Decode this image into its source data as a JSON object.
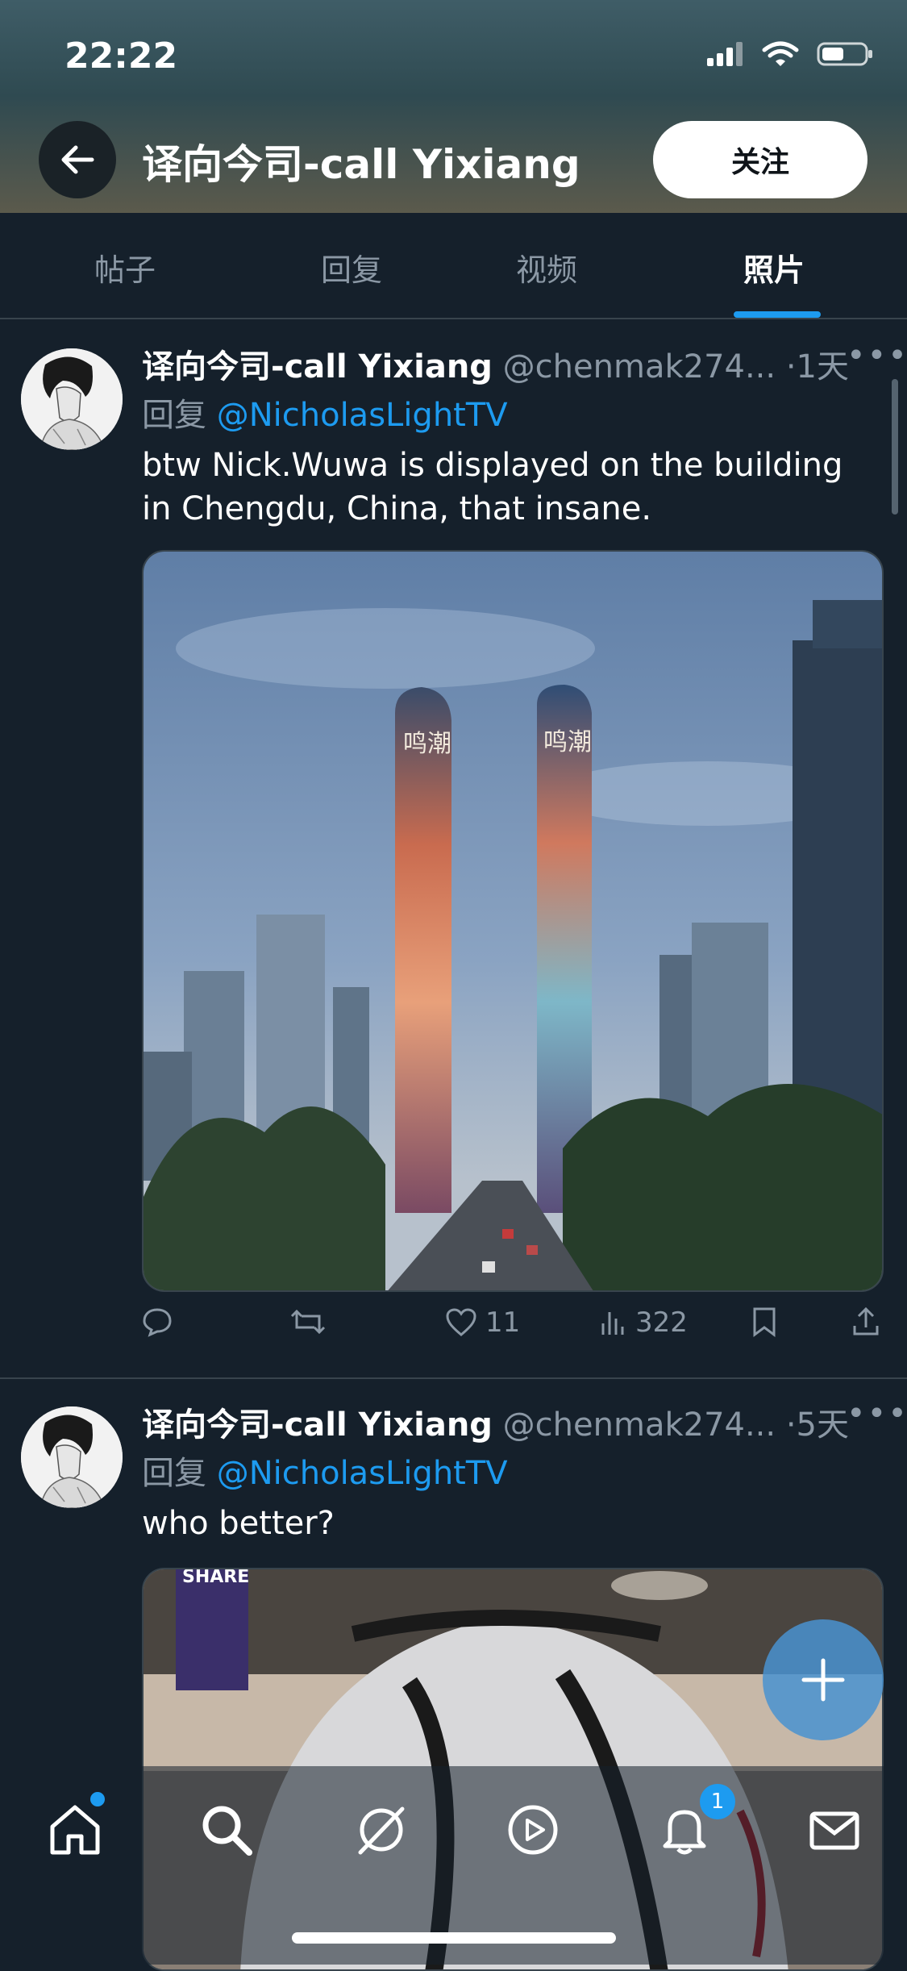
{
  "status_bar": {
    "time": "22:22"
  },
  "header": {
    "title": "译向今司-call Yixiang",
    "follow_label": "关注"
  },
  "tabs": [
    {
      "label": "帖子",
      "active": false
    },
    {
      "label": "回复",
      "active": false
    },
    {
      "label": "视频",
      "active": false
    },
    {
      "label": "照片",
      "active": true
    }
  ],
  "posts": [
    {
      "name": "译向今司-call Yixiang",
      "handle": "@chenmak274...",
      "separator": "·",
      "time_ago": "1天",
      "reply_prefix": "回复",
      "reply_to": "@NicholasLightTV",
      "text": "btw Nick.Wuwa is displayed on the building in Chengdu, China, that insane.",
      "tower_sign_left": "鸣潮",
      "tower_sign_right": "鸣潮",
      "stats": {
        "likes": "11",
        "views": "322"
      }
    },
    {
      "name": "译向今司-call Yixiang",
      "handle": "@chenmak274...",
      "separator": "·",
      "time_ago": "5天",
      "reply_prefix": "回复",
      "reply_to": "@NicholasLightTV",
      "text": "who better?",
      "banner_text": "SHARE"
    }
  ],
  "bottom_nav": {
    "notification_badge": "1"
  },
  "colors": {
    "accent": "#1d9bf0",
    "background": "#15202b",
    "muted": "#8b98a5"
  }
}
